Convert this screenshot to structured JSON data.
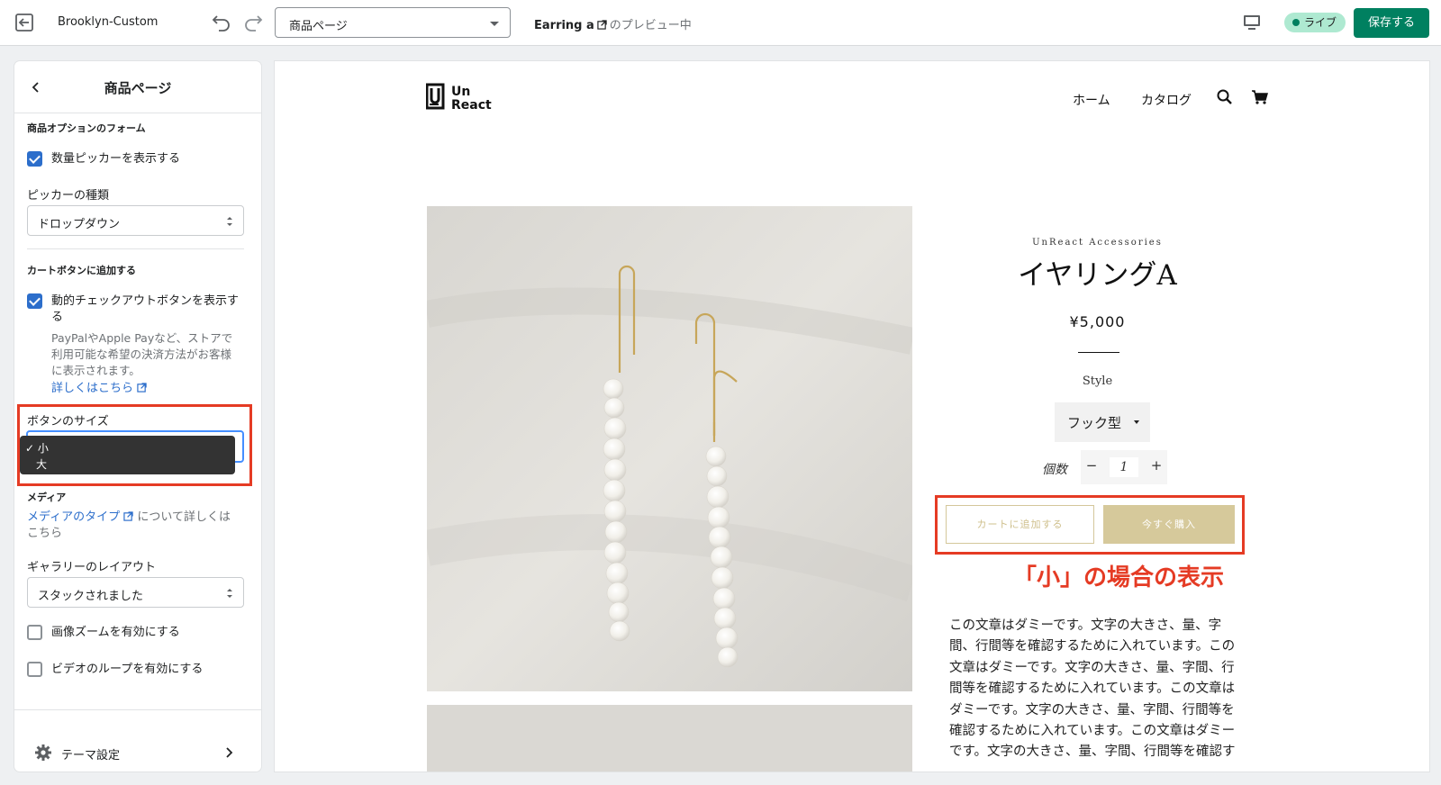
{
  "topbar": {
    "store_name": "Brooklyn-Custom",
    "page_select": "商品ページ",
    "preview_product": "Earring a",
    "preview_suffix": "のプレビュー中",
    "live_badge": "ライブ",
    "save_label": "保存する"
  },
  "sidebar": {
    "title": "商品ページ",
    "section_product_form": "商品オプションのフォーム",
    "show_qty_picker": "数量ピッカーを表示する",
    "picker_type_label": "ピッカーの種類",
    "picker_type_value": "ドロップダウン",
    "section_cart_button": "カートボタンに追加する",
    "dynamic_checkout_line1": "動的チェックアウトボタンを表示す",
    "dynamic_checkout_line2": "る",
    "dynamic_help_line1": "PayPalやApple Payなど、ストアで",
    "dynamic_help_line2": "利用可能な希望の決済方法がお客様",
    "dynamic_help_line3": "に表示されます。",
    "learn_more": "詳しくはこちら",
    "button_size_label": "ボタンのサイズ",
    "size_options": [
      "小",
      "大"
    ],
    "size_selected": "小",
    "section_media": "メディア",
    "media_link": "メディアのタイプ",
    "media_text_1": "について詳しくは",
    "media_text_2": "こちら",
    "gallery_label": "ギャラリーのレイアウト",
    "gallery_value": "スタックされました",
    "enable_zoom": "画像ズームを有効にする",
    "enable_video_loop": "ビデオのループを有効にする",
    "theme_settings": "テーマ設定"
  },
  "preview": {
    "logo_line1": "Un",
    "logo_line2": "React",
    "nav_home": "ホーム",
    "nav_catalog": "カタログ",
    "brand": "UnReact Accessories",
    "product_title": "イヤリングA",
    "price": "¥5,000",
    "option_label": "Style",
    "variant_value": "フック型",
    "qty_label": "個数",
    "qty_minus": "−",
    "qty_value": "1",
    "qty_plus": "+",
    "add_to_cart": "カートに追加する",
    "buy_now": "今すぐ購入",
    "annotation": "「小」の場合の表示",
    "description_lines": [
      "この文章はダミーです。文字の大きさ、量、字",
      "間、行間等を確認するために入れています。この",
      "文章はダミーです。文字の大きさ、量、字間、行",
      "間等を確認するために入れています。この文章は",
      "ダミーです。文字の大きさ、量、字間、行間等を",
      "確認するために入れています。この文章はダミー",
      "です。文字の大きさ、量、字間、行間等を確認す"
    ]
  },
  "colors": {
    "accent_green": "#008060",
    "checkbox_blue": "#2c6ecb",
    "annotation_red": "#e53b24",
    "gold_button": "#d6c99b"
  }
}
